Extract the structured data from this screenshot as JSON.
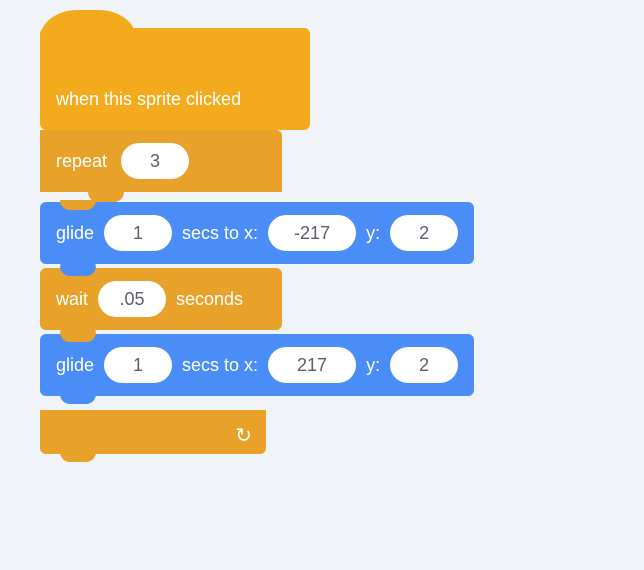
{
  "colors": {
    "event": "#f3ab1d",
    "control": "#e8a22a",
    "motion": "#4a8df6",
    "input_bg": "#ffffff",
    "input_text": "#5a5f6b"
  },
  "hat": {
    "label": "when this sprite clicked"
  },
  "repeat": {
    "label": "repeat",
    "count": "3",
    "children": [
      {
        "type": "glide",
        "label_pre": "glide",
        "secs": "1",
        "label_mid": "secs to x:",
        "x": "-217",
        "label_y": "y:",
        "y": "2"
      },
      {
        "type": "wait",
        "label_pre": "wait",
        "secs": ".05",
        "label_post": "seconds"
      },
      {
        "type": "glide",
        "label_pre": "glide",
        "secs": "1",
        "label_mid": "secs to x:",
        "x": "217",
        "label_y": "y:",
        "y": "2"
      }
    ]
  }
}
